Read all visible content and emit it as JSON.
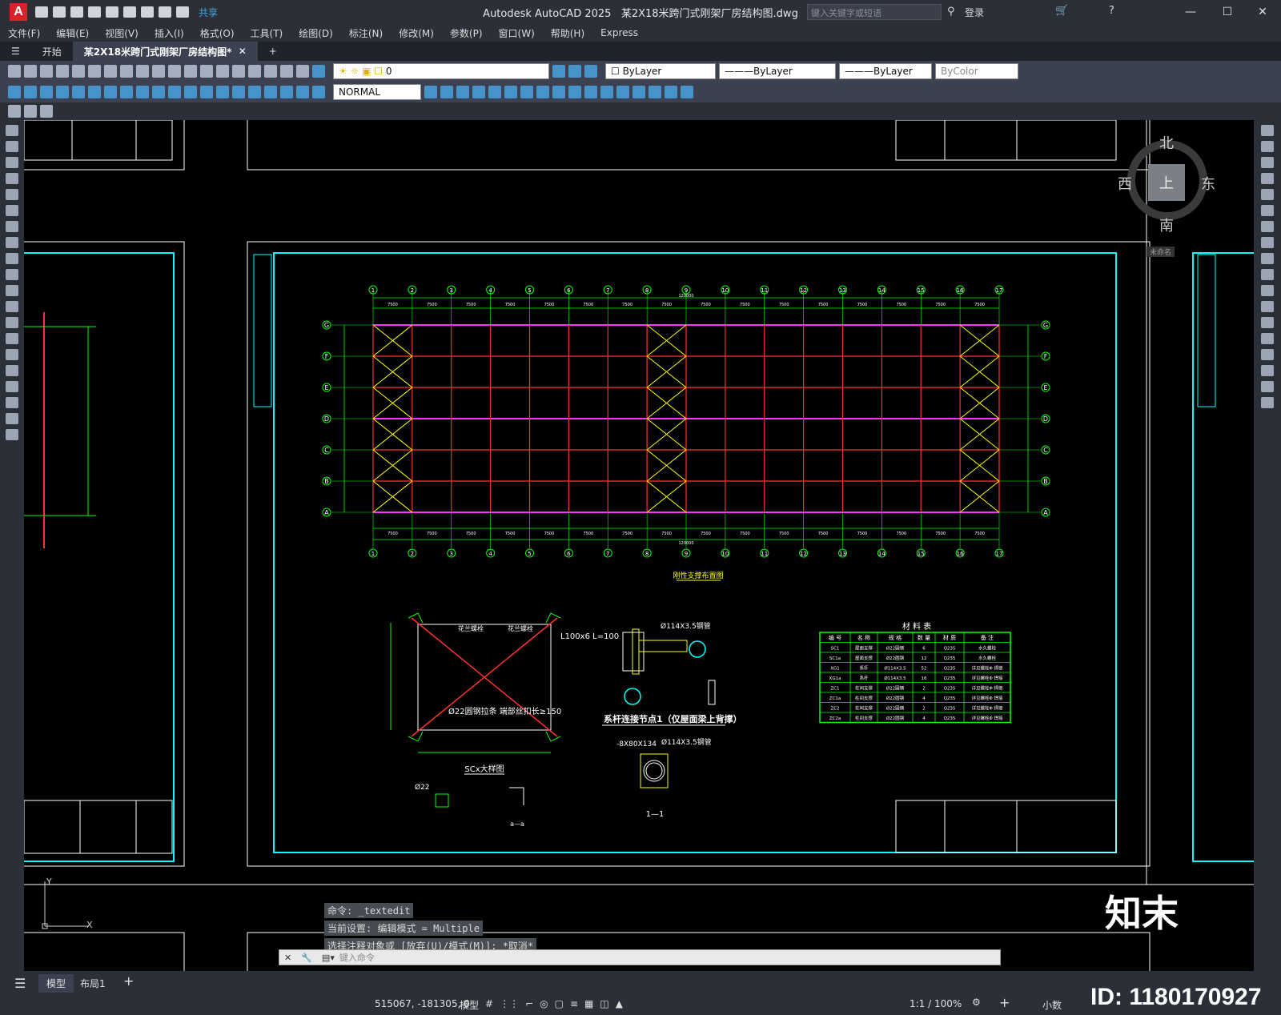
{
  "app": {
    "title": "Autodesk AutoCAD 2025",
    "file": "某2X18米跨门式刚架厂房结构图.dwg",
    "search_placeholder": "键入关键字或短语",
    "login": "登录",
    "share": "共享"
  },
  "menu": [
    "文件(F)",
    "编辑(E)",
    "视图(V)",
    "插入(I)",
    "格式(O)",
    "工具(T)",
    "绘图(D)",
    "标注(N)",
    "修改(M)",
    "参数(P)",
    "窗口(W)",
    "帮助(H)",
    "Express"
  ],
  "tabs": {
    "start": "开始",
    "doc": "某2X18米跨门式刚架厂房结构图*"
  },
  "toolbar": {
    "layer": "0",
    "color": "ByLayer",
    "linetype": "ByLayer",
    "lineweight": "ByLayer",
    "plotstyle": "ByColor",
    "textstyle": "NORMAL"
  },
  "viewcube": {
    "north": "北",
    "south": "南",
    "east": "东",
    "west": "西",
    "top": "上",
    "unnamed": "未命名"
  },
  "drawing": {
    "plan_title": "刚性支撑布置图",
    "axes_cols": [
      "1",
      "2",
      "3",
      "4",
      "5",
      "6",
      "7",
      "8",
      "9",
      "10",
      "11",
      "12",
      "13",
      "14",
      "15",
      "16",
      "17"
    ],
    "axes_rows": [
      "G",
      "F",
      "E",
      "D",
      "C",
      "B",
      "A"
    ],
    "bay": "7500",
    "total": "120000",
    "detail_title": "SCx大样图",
    "detail_note": "Ø22圆钢拉条 端部丝扣长≥150",
    "angle_note": "L100x6 L=100",
    "flange_label": "花兰螺栓",
    "node_title": "系杆连接节点1（仅屋面梁上背撑）",
    "pipe": "Ø114X3.5钢管",
    "plate": "-8X80X134",
    "section": "1—1",
    "sect_a": "a—a",
    "rod": "Ø22",
    "table_title": "材 料 表",
    "table_head": [
      "编 号",
      "名 称",
      "规 格",
      "数 量",
      "材 质",
      "备 注"
    ],
    "table_rows": [
      [
        "SC1",
        "屋面支撑",
        "Ø22圆钢",
        "6",
        "Q235",
        "水久螺栓"
      ],
      [
        "SC1a",
        "屋面支撑",
        "Ø22圆钢",
        "12",
        "Q235",
        "水久螺栓"
      ],
      [
        "XG1",
        "系杆",
        "Ø114X3.5",
        "52",
        "Q235",
        "详见螺栓Φ 焊接"
      ],
      [
        "XG1a",
        "系杆",
        "Ø114X3.5",
        "16",
        "Q235",
        "详见螺栓Φ 焊接"
      ],
      [
        "ZC1",
        "柱间支撑",
        "Ø22圆钢",
        "2",
        "Q235",
        "详见螺栓Φ 焊接"
      ],
      [
        "ZC1a",
        "柱间支撑",
        "Ø22圆钢",
        "4",
        "Q235",
        "详见螺栓Φ 焊接"
      ],
      [
        "ZC2",
        "柱间支撑",
        "Ø22圆钢",
        "2",
        "Q235",
        "详见螺栓Φ 焊接"
      ],
      [
        "ZC2a",
        "柱间支撑",
        "Ø22圆钢",
        "4",
        "Q235",
        "详见螺栓Φ 焊接"
      ]
    ]
  },
  "command": {
    "line1": "命令: _textedit",
    "line2": "当前设置: 编辑模式 = Multiple",
    "line3": "选择注释对象或 [放弃(U)/模式(M)]: *取消*",
    "placeholder": "键入命令"
  },
  "status": {
    "model": "模型",
    "layout": "布局1",
    "coords": "515067, -181305, 0",
    "model_btn": "模型",
    "scale": "1:1 / 100%",
    "units": "小数"
  },
  "overlay": {
    "brand": "知末",
    "id": "ID: 1180170927"
  }
}
